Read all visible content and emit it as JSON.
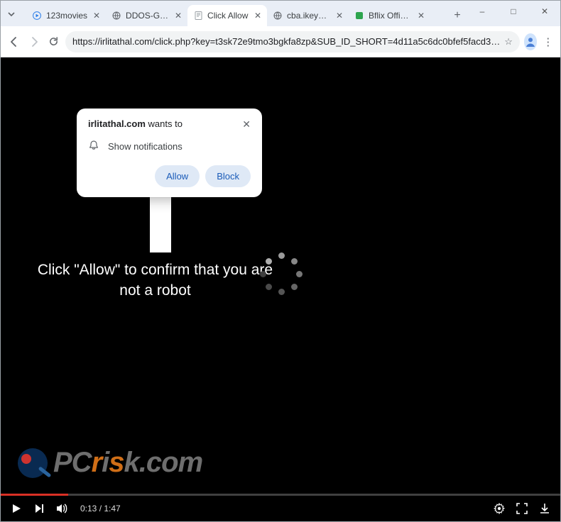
{
  "window": {
    "tabs": [
      {
        "label": "123movies",
        "favicon": "play"
      },
      {
        "label": "DDOS-GUARD",
        "favicon": "globe"
      },
      {
        "label": "Click Allow",
        "favicon": "doc",
        "active": true
      },
      {
        "label": "cba.ikeymonitor",
        "favicon": "globe"
      },
      {
        "label": "Bflix Official",
        "favicon": "green"
      }
    ],
    "controls": {
      "minimize": "–",
      "maximize": "□",
      "close": "✕"
    }
  },
  "addressbar": {
    "url": "https://irlitathal.com/click.php?key=t3sk72e9tmo3bgkfa8zp&SUB_ID_SHORT=4d11a5c6dc0bfef5facd3…"
  },
  "permission": {
    "site": "irlitathal.com",
    "wants_to": " wants to",
    "item": "Show notifications",
    "allow": "Allow",
    "block": "Block"
  },
  "page": {
    "message": "Click \"Allow\" to confirm that you are not a robot",
    "watermark": "PCrisk.com"
  },
  "video": {
    "current": "0:13",
    "sep": " / ",
    "duration": "1:47",
    "played_percent": 12
  }
}
